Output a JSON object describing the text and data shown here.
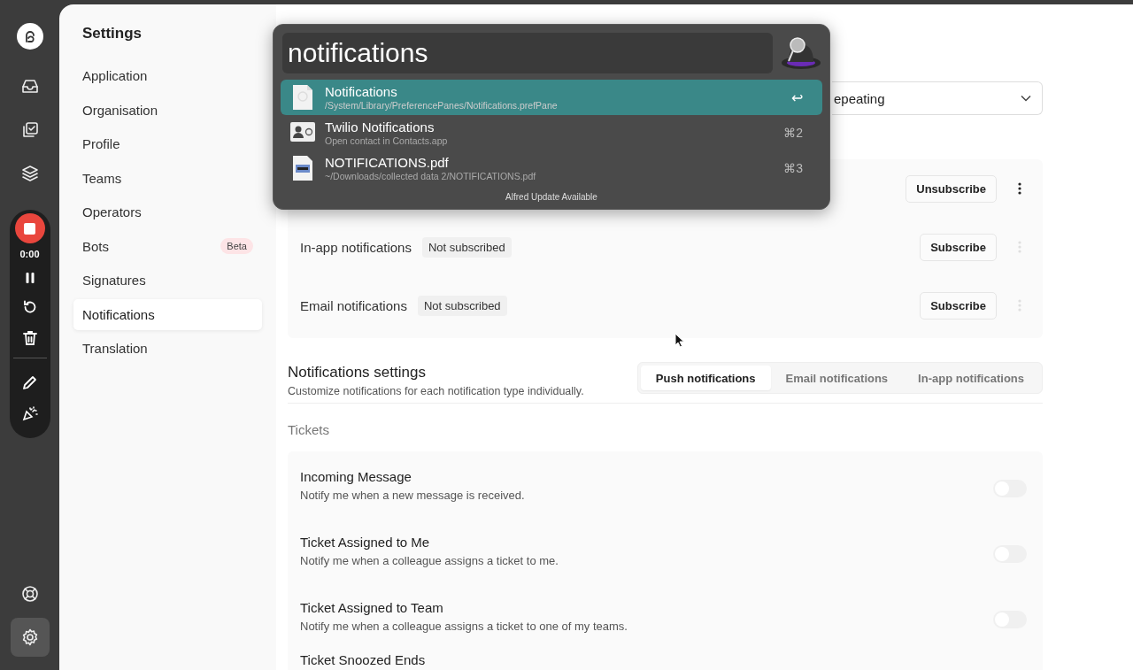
{
  "rail": {
    "items": [
      {
        "kind": "inbox",
        "selected": false
      },
      {
        "kind": "tasks",
        "selected": false
      },
      {
        "kind": "layers",
        "selected": false
      }
    ],
    "bottom_items": [
      {
        "kind": "help",
        "selected": false
      },
      {
        "kind": "settings",
        "selected": true
      }
    ]
  },
  "recorder": {
    "time": "0:00"
  },
  "settings_nav": {
    "title": "Settings",
    "items": [
      {
        "label": "Application",
        "selected": false
      },
      {
        "label": "Organisation",
        "selected": false
      },
      {
        "label": "Profile",
        "selected": false
      },
      {
        "label": "Teams",
        "selected": false
      },
      {
        "label": "Operators",
        "selected": false
      },
      {
        "label": "Bots",
        "selected": false,
        "badge": "Beta"
      },
      {
        "label": "Signatures",
        "selected": false
      },
      {
        "label": "Notifications",
        "selected": true
      },
      {
        "label": "Translation",
        "selected": false
      }
    ]
  },
  "delivery_select": {
    "value": "epeating"
  },
  "channels": [
    {
      "button": "Unsubscribe",
      "menu_disabled": false
    },
    {
      "name": "In-app notifications",
      "status": "Not subscribed",
      "button": "Subscribe",
      "menu_disabled": true
    },
    {
      "name": "Email notifications",
      "status": "Not subscribed",
      "button": "Subscribe",
      "menu_disabled": true
    }
  ],
  "notification_settings": {
    "title": "Notifications settings",
    "subtitle": "Customize notifications for each notification type individually.",
    "tabs": [
      {
        "label": "Push notifications",
        "selected": true
      },
      {
        "label": "Email notifications",
        "selected": false
      },
      {
        "label": "In-app notifications",
        "selected": false
      }
    ]
  },
  "section": "Tickets",
  "events": [
    {
      "title": "Incoming Message",
      "description": "Notify me when a new message is received.",
      "on": false
    },
    {
      "title": "Ticket Assigned to Me",
      "description": "Notify me when a colleague assigns a ticket to me.",
      "on": false
    },
    {
      "title": "Ticket Assigned to Team",
      "description": "Notify me when a colleague assigns a ticket to one of my teams.",
      "on": false
    },
    {
      "title": "Ticket Snoozed Ends"
    }
  ],
  "launcher": {
    "query": "notifications",
    "results": [
      {
        "kind": "prefpane",
        "title": "Notifications",
        "subtitle": "/System/Library/PreferencePanes/Notifications.prefPane",
        "shortcut": "↩",
        "selected": true
      },
      {
        "kind": "contact",
        "title": "Twilio Notifications",
        "subtitle": "Open contact in Contacts.app",
        "shortcut": "⌘2",
        "selected": false
      },
      {
        "kind": "pdf",
        "title": "NOTIFICATIONS.pdf",
        "subtitle": "~/Downloads/collected data 2/NOTIFICATIONS.pdf",
        "shortcut": "⌘3",
        "selected": false
      }
    ],
    "footer": "Alfred Update Available"
  }
}
